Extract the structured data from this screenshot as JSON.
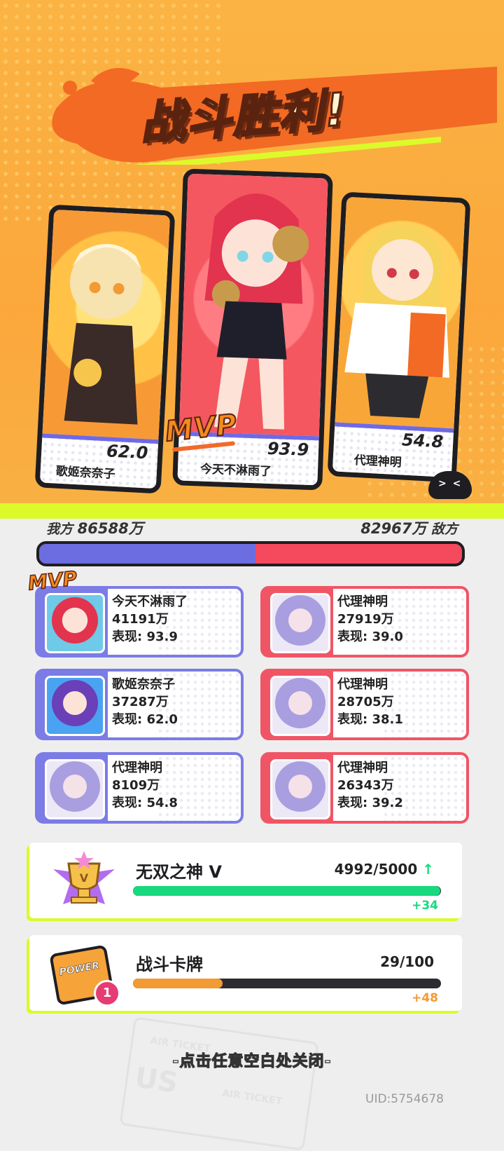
{
  "title": "战斗胜利!",
  "mvp_label": "MVP",
  "cards": [
    {
      "name": "歌姬奈奈子",
      "score": "62.0"
    },
    {
      "name": "今天不淋雨了",
      "score": "93.9"
    },
    {
      "name": "代理神明",
      "score": "54.8"
    }
  ],
  "blob_face": "> <",
  "team_scores": {
    "ally_label": "我方",
    "ally_value": "86588万",
    "enemy_value": "82967万",
    "enemy_label": "敌方",
    "ally_share": 0.511
  },
  "ally_players": [
    {
      "name": "今天不淋雨了",
      "damage": "41191万",
      "performance": "表现: 93.9"
    },
    {
      "name": "歌姬奈奈子",
      "damage": "37287万",
      "performance": "表现: 62.0"
    },
    {
      "name": "代理神明",
      "damage": "8109万",
      "performance": "表现: 54.8"
    }
  ],
  "enemy_players": [
    {
      "name": "代理神明",
      "damage": "27919万",
      "performance": "表现: 39.0"
    },
    {
      "name": "代理神明",
      "damage": "28705万",
      "performance": "表现: 38.1"
    },
    {
      "name": "代理神明",
      "damage": "26343万",
      "performance": "表现: 39.2"
    }
  ],
  "rank_progress": {
    "title": "无双之神 V",
    "value": "4992/5000",
    "fraction": 0.998,
    "delta": "+34",
    "color": "#18d97e"
  },
  "card_progress": {
    "title": "战斗卡牌",
    "value": "29/100",
    "fraction": 0.29,
    "delta": "+48",
    "color": "#f29a34",
    "badge": "1",
    "card_text": "POWER"
  },
  "close_hint": "-点击任意空白处关闭-",
  "uid": "UID:5754678",
  "ticket_text": [
    "AIR TICKET",
    "US",
    "AIR TICKET"
  ]
}
